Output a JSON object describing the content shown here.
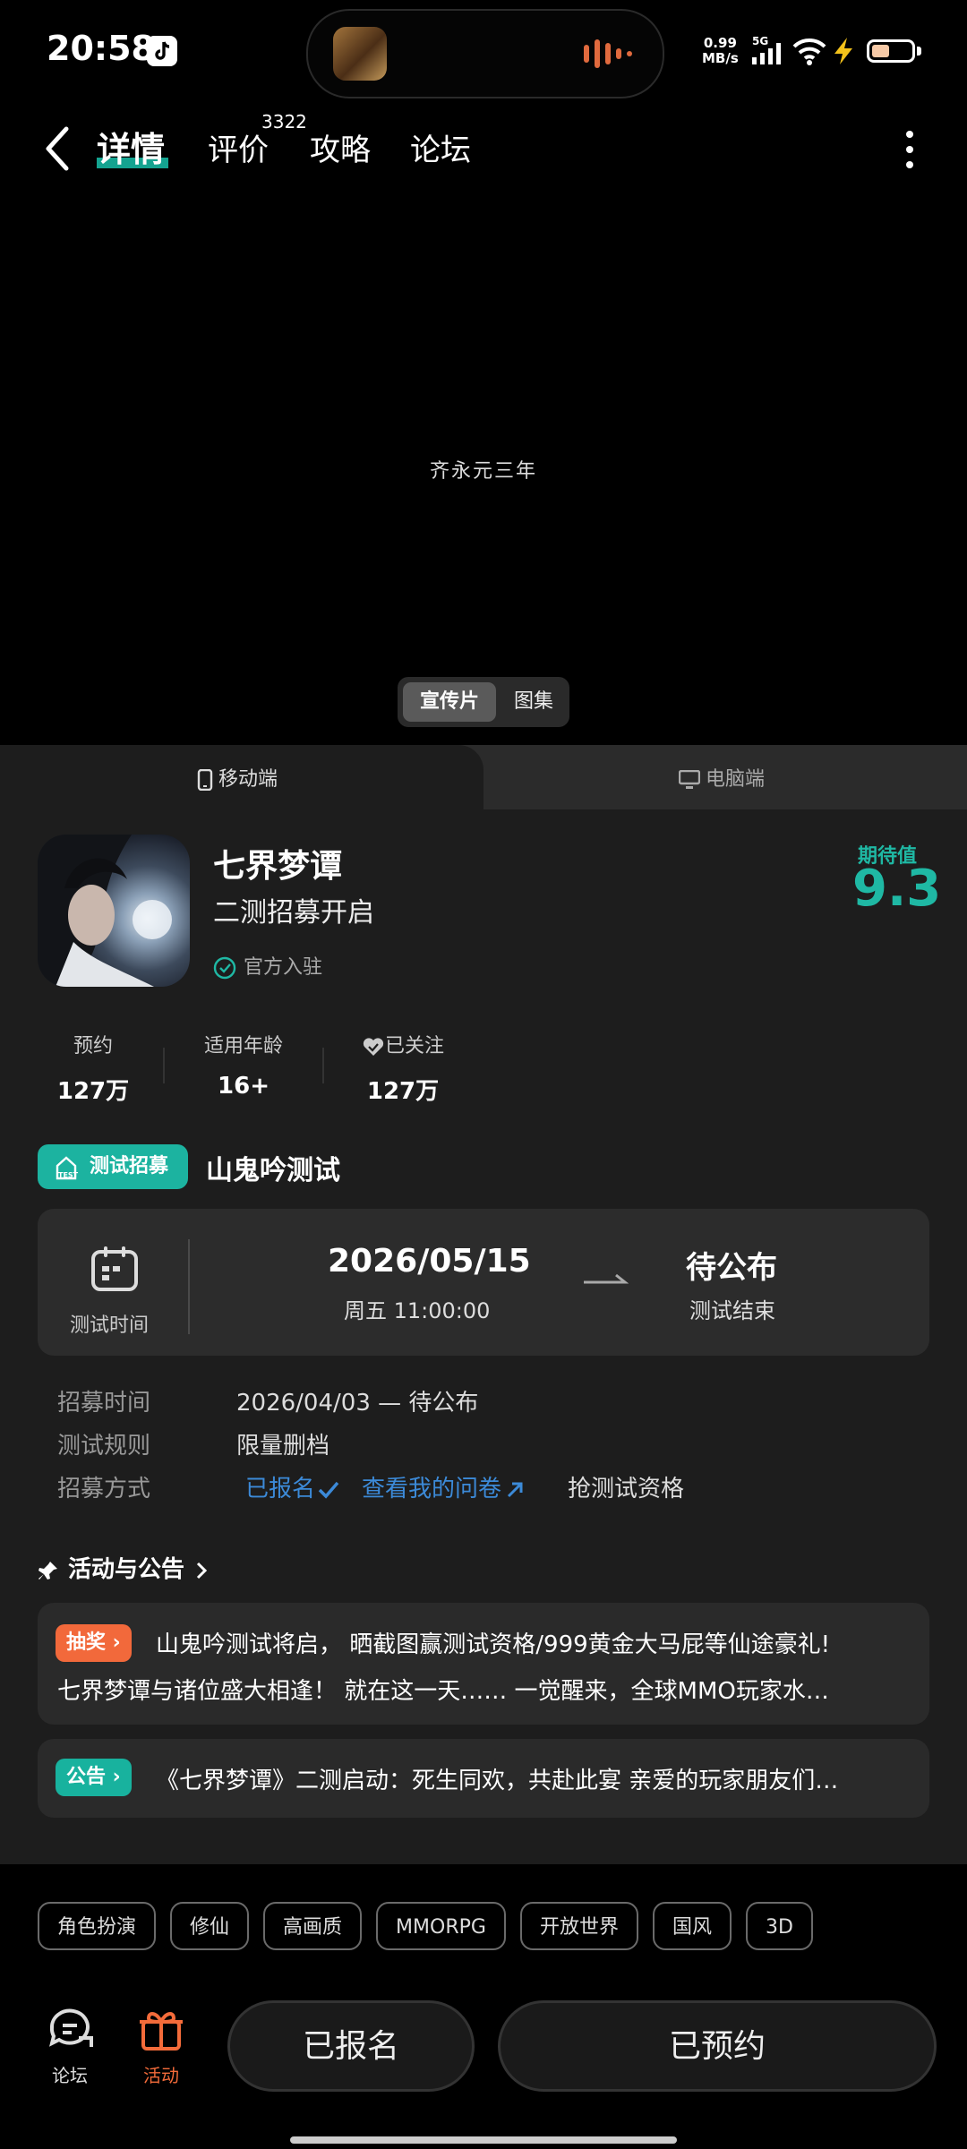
{
  "status": {
    "time": "20:58",
    "net_speed_value": "0.99",
    "net_speed_unit": "MB/s",
    "network_type": "5G",
    "battery_level": 0.45,
    "icons": [
      "tiktok-icon",
      "waveform-icon",
      "signal-icon",
      "wifi-icon",
      "bolt-icon",
      "battery-icon"
    ]
  },
  "nav": {
    "tabs": [
      "详情",
      "评价",
      "攻略",
      "论坛"
    ],
    "review_count": "3322",
    "active_tab": "详情"
  },
  "video": {
    "caption": "齐永元三年",
    "media_tabs": [
      "宣传片",
      "图集"
    ],
    "active_media": "宣传片"
  },
  "platforms": [
    "移动端",
    "电脑端"
  ],
  "game": {
    "title": "七界梦谭",
    "subtitle": "二测招募开启",
    "official": "官方入驻",
    "expect_label": "期待值",
    "expect_value": "9.3"
  },
  "stats": [
    {
      "label": "预约",
      "value": "127万"
    },
    {
      "label": "适用年龄",
      "value": "16+"
    },
    {
      "label": "已关注",
      "value": "127万"
    }
  ],
  "recruit": {
    "badge": "测试招募",
    "title": "山鬼吟测试"
  },
  "test": {
    "time_label": "测试时间",
    "start_date": "2026/05/15",
    "start_time": "周五  11:00:00",
    "end_date": "待公布",
    "end_label": "测试结束"
  },
  "info": {
    "recruit_time_label": "招募时间",
    "recruit_time": "2026/04/03 — 待公布",
    "rule_label": "测试规则",
    "rule": "限量删档",
    "method_label": "招募方式",
    "signed": "已报名",
    "survey": "查看我的问卷",
    "grab": "抢测试资格"
  },
  "activities": {
    "header": "活动与公告",
    "items": [
      {
        "badge": "抽奖",
        "line1": "山鬼吟测试将启， 晒截图赢测试资格/999黄金大马屁等仙途豪礼!",
        "line2": "七界梦谭与诸位盛大相逢！ 就在这一天…… 一觉醒来，全球MMO玩家水…"
      },
      {
        "badge": "公告",
        "line1": "《七界梦谭》二测启动：死生同欢，共赴此宴 亲爱的玩家朋友们…"
      }
    ]
  },
  "tags": [
    "角色扮演",
    "修仙",
    "高画质",
    "MMORPG",
    "开放世界",
    "国风",
    "3D"
  ],
  "bottom": {
    "forum": "论坛",
    "activity": "活动",
    "signup": "已报名",
    "reserve": "已预约"
  },
  "colors": {
    "accent": "#1fb8a4",
    "orange": "#f36b3a",
    "link": "#3c8ad8"
  }
}
